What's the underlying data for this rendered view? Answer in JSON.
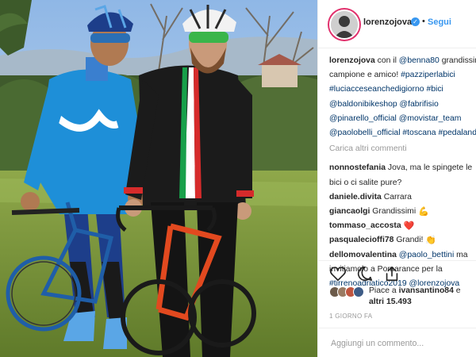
{
  "post": {
    "username": "lorenzojova",
    "follow_label": "Segui",
    "verified_icon": "verified-badge-icon"
  },
  "caption": {
    "user": "lorenzojova",
    "line1_text": "con il",
    "line1_mention": "@benna80",
    "line1_tail": "grandissimo",
    "line2_text": "campione e amico!",
    "line2_tag": "#pazziperlabici",
    "line3_tag1": "#luciacceseanchedigiorno",
    "line3_tag2": "#bici",
    "line4_tag": "@baldonibikeshop",
    "line4_tag2": "@fabrifisio",
    "line5_tag1": "@pinarello_official",
    "line5_tag2": "@movistar_team",
    "line6_tag1": "@paolobelli_official",
    "line6_tag2": "#toscana",
    "line6_tag3": "#pedalando"
  },
  "load_more": "Carica altri commenti",
  "comments": [
    {
      "user": "nonnostefania",
      "text": "Jova, ma le spingete le"
    },
    {
      "user": "",
      "text": "bici o ci salite pure?"
    },
    {
      "user": "daniele.divita",
      "text": "Carrara"
    },
    {
      "user": "giancaolgi",
      "text": "Grandissimi",
      "emoji": "💪"
    },
    {
      "user": "tommaso_accosta",
      "text": "",
      "emoji": "❤️"
    },
    {
      "user": "pasqualecioffi78",
      "text": "Grandi!",
      "emoji": "👏"
    },
    {
      "user": "dellomovalentina",
      "mention": "@paolo_bettini",
      "text": "ma"
    },
    {
      "user": "",
      "text": "invitiamolo a Pomarance per la"
    },
    {
      "user": "",
      "tag": "#tirrenoadriatico2019",
      "mention2": "@lorenzojova"
    }
  ],
  "likes": {
    "prefix": "Piace a",
    "liker": "ivansantino84",
    "suffix": "e",
    "line2_prefix": "altri",
    "count": "15.493"
  },
  "timestamp": "1 GIORNO FA",
  "add_comment_placeholder": "Aggiungi un commento...",
  "colors": {
    "link": "#3897f0",
    "hashtag": "#003569",
    "muted": "#999999",
    "jersey_blue": "#1e8fd8"
  }
}
